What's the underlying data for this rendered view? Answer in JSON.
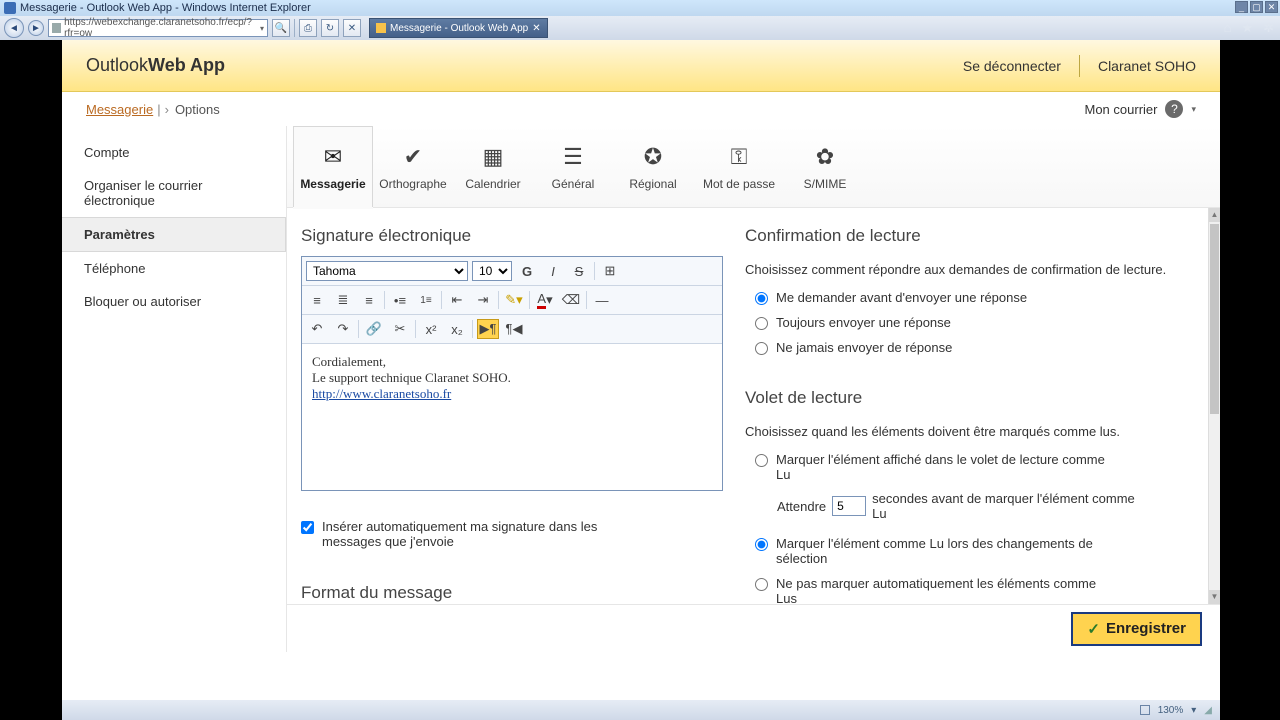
{
  "window": {
    "title": "Messagerie - Outlook Web App - Windows Internet Explorer"
  },
  "addressbar": {
    "url": "https://webexchange.claranetsoho.fr/ecp/?rfr=ow"
  },
  "browser_tab": {
    "label": "Messagerie - Outlook Web App"
  },
  "brand": {
    "name_light": "Outlook",
    "name_bold": "Web App",
    "signout": "Se déconnecter",
    "user": "Claranet SOHO"
  },
  "breadcrumb": {
    "root": "Messagerie",
    "current": "Options",
    "mail_link": "Mon courrier"
  },
  "sidebar": {
    "items": [
      {
        "label": "Compte"
      },
      {
        "label": "Organiser le courrier électronique"
      },
      {
        "label": "Paramètres"
      },
      {
        "label": "Téléphone"
      },
      {
        "label": "Bloquer ou autoriser"
      }
    ],
    "active_index": 2
  },
  "tabs": {
    "items": [
      {
        "label": "Messagerie",
        "icon": "✉"
      },
      {
        "label": "Orthographe",
        "icon": "✔"
      },
      {
        "label": "Calendrier",
        "icon": "▦"
      },
      {
        "label": "Général",
        "icon": "☰"
      },
      {
        "label": "Régional",
        "icon": "✪"
      },
      {
        "label": "Mot de passe",
        "icon": "⚿"
      },
      {
        "label": "S/MIME",
        "icon": "✿"
      }
    ],
    "active_index": 0
  },
  "signature": {
    "heading": "Signature électronique",
    "font_family": "Tahoma",
    "font_size": "10",
    "body_line1": "Cordialement,",
    "body_line2": "Le support technique Claranet SOHO.",
    "body_link": "http://www.claranetsoho.fr",
    "autoinsert_label": "Insérer automatiquement ma signature dans les messages que j'envoie",
    "autoinsert_checked": true
  },
  "format": {
    "heading": "Format du message"
  },
  "read_receipt": {
    "heading": "Confirmation de lecture",
    "desc": "Choisissez comment répondre aux demandes de confirmation de lecture.",
    "options": [
      "Me demander avant d'envoyer une réponse",
      "Toujours envoyer une réponse",
      "Ne jamais envoyer de réponse"
    ],
    "selected": 0
  },
  "reading_pane": {
    "heading": "Volet de lecture",
    "desc": "Choisissez quand les éléments doivent être marqués comme lus.",
    "opt1": "Marquer l'élément affiché dans le volet de lecture comme Lu",
    "wait_before": "Attendre",
    "wait_value": "5",
    "wait_after": "secondes avant de marquer l'élément comme Lu",
    "opt2": "Marquer l'élément comme Lu lors des changements de sélection",
    "opt3": "Ne pas marquer automatiquement les éléments comme Lus",
    "selected": 1
  },
  "save": {
    "label": "Enregistrer"
  },
  "status": {
    "zoom": "130%"
  }
}
